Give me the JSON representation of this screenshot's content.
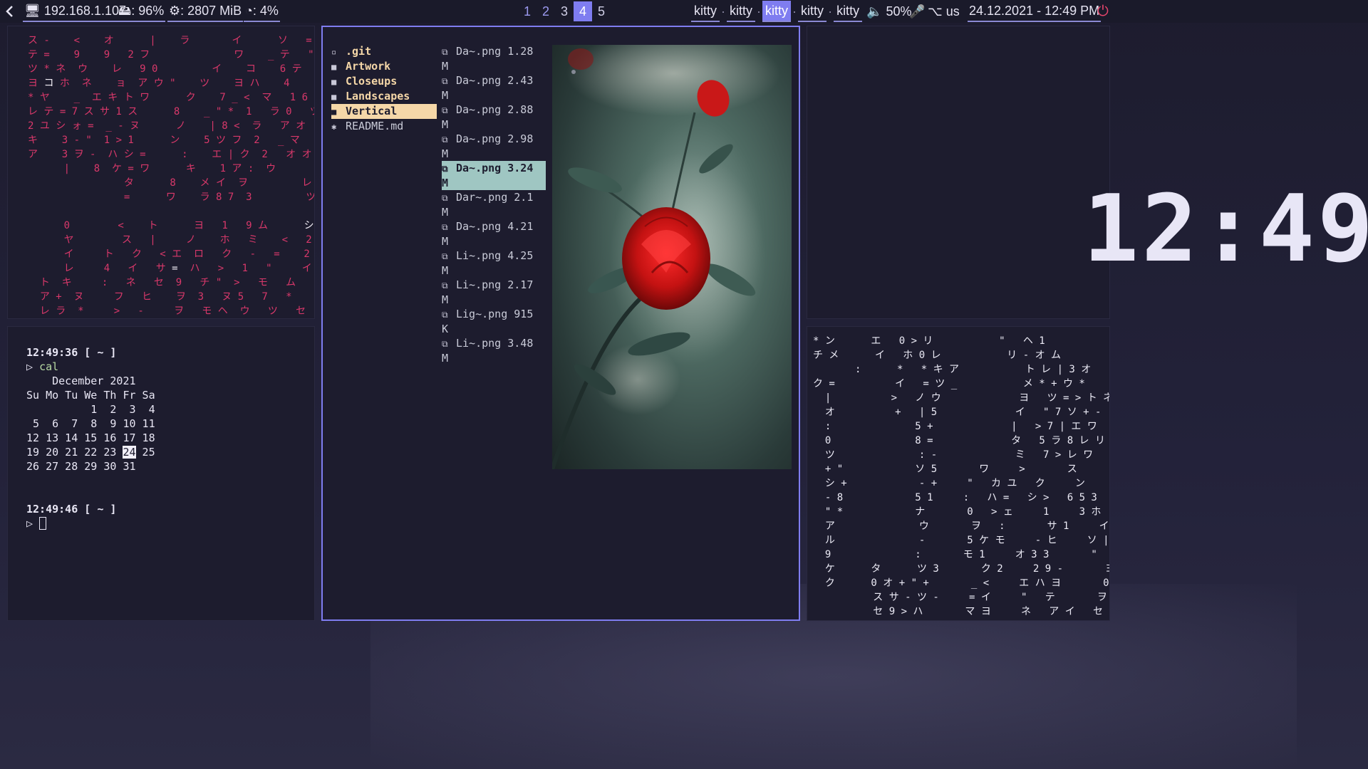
{
  "bar": {
    "back_icon": "chevron-left-icon",
    "ip": "192.168.1.107",
    "disk": ": 96%",
    "memory": ": 2807 MiB",
    "cpu": ": 4%",
    "workspaces": [
      "1",
      "2",
      "3",
      "4",
      "5"
    ],
    "active_workspace": "4",
    "tabs": [
      "kitty",
      "kitty",
      "kitty",
      "kitty",
      "kitty"
    ],
    "active_tab_index": 2,
    "volume": "50%",
    "keyboard": "us",
    "datetime": "24.12.2021 - 12:49 PM",
    "accent": "#7f7df0"
  },
  "terminal": {
    "prompt1": "12:49:36 [ ~ ]",
    "cmd1": "cal",
    "cal_title": "December 2021",
    "cal_header": "Su Mo Tu We Th Fr Sa",
    "cal_rows": [
      "          1  2  3  4",
      " 5  6  7  8  9 10 11",
      "12 13 14 15 16 17 18",
      "19 20 21 22 23 ",
      "26 27 28 29 30 31"
    ],
    "today": "24",
    "after_today": " 25",
    "prompt2": "12:49:46 [ ~ ]"
  },
  "file_manager": {
    "dirs": [
      ".git",
      "Artwork",
      "Closeups",
      "Landscapes",
      "Vertical",
      "README.md"
    ],
    "selected_dir": "Vertical",
    "files": [
      "Da~.png 1.28 M",
      "Da~.png 2.43 M",
      "Da~.png 2.88 M",
      "Da~.png 2.98 M",
      "Da~.png 3.24 M",
      "Dar~.png 2.1 M",
      "Da~.png 4.21 M",
      "Li~.png 4.25 M",
      "Li~.png 2.17 M",
      "Lig~.png 915 K",
      "Li~.png 3.48 M"
    ],
    "selected_file_index": 4
  },
  "clock": {
    "time": "12:49"
  },
  "colors": {
    "rain": "#d8386a",
    "dir": "#f5d7a8",
    "selection": "#9fc6c2"
  }
}
